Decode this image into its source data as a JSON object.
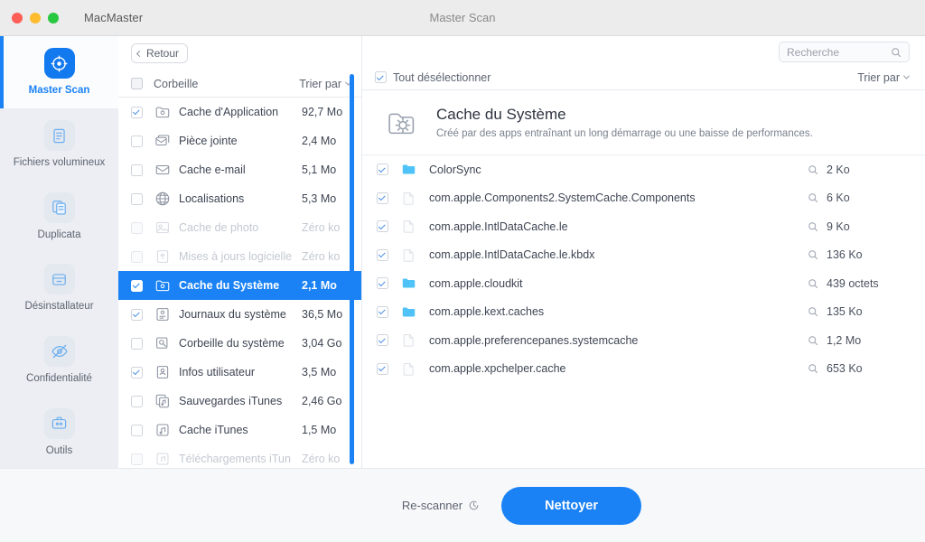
{
  "window": {
    "app_name": "MacMaster",
    "title": "Master Scan"
  },
  "sidebar": {
    "items": [
      {
        "label": "Master Scan",
        "icon": "target-scan-icon",
        "active": true
      },
      {
        "label": "Fichiers volumineux",
        "icon": "document-icon",
        "active": false
      },
      {
        "label": "Duplicata",
        "icon": "copy-documents-icon",
        "active": false
      },
      {
        "label": "Désinstallateur",
        "icon": "box-icon",
        "active": false
      },
      {
        "label": "Confidentialité",
        "icon": "eye-off-icon",
        "active": false
      },
      {
        "label": "Outils",
        "icon": "toolbox-icon",
        "active": false
      }
    ]
  },
  "toolbar": {
    "back_label": "Retour",
    "search_placeholder": "Recherche"
  },
  "middle_panel": {
    "header_title": "Corbeille",
    "sort_label": "Trier par",
    "rows": [
      {
        "name": "Cache d'Application",
        "size": "92,7 Mo",
        "checked": true,
        "dim": false,
        "selected": false,
        "icon": "app-cache-folder-icon"
      },
      {
        "name": "Pièce jointe",
        "size": "2,4 Mo",
        "checked": false,
        "dim": false,
        "selected": false,
        "icon": "mail-attachment-icon"
      },
      {
        "name": "Cache e-mail",
        "size": "5,1 Mo",
        "checked": false,
        "dim": false,
        "selected": false,
        "icon": "mail-icon"
      },
      {
        "name": "Localisations",
        "size": "5,3 Mo",
        "checked": false,
        "dim": false,
        "selected": false,
        "icon": "globe-icon"
      },
      {
        "name": "Cache de photo",
        "size": "Zéro ko",
        "checked": false,
        "dim": true,
        "selected": false,
        "icon": "photo-cache-icon"
      },
      {
        "name": "Mises à jours logicielle",
        "size": "Zéro ko",
        "checked": false,
        "dim": true,
        "selected": false,
        "icon": "software-update-icon"
      },
      {
        "name": "Cache du Système",
        "size": "2,1 Mo",
        "checked": true,
        "dim": false,
        "selected": true,
        "icon": "system-cache-icon"
      },
      {
        "name": "Journaux du système",
        "size": "36,5 Mo",
        "checked": true,
        "dim": false,
        "selected": false,
        "icon": "system-logs-icon"
      },
      {
        "name": "Corbeille du système",
        "size": "3,04 Go",
        "checked": false,
        "dim": false,
        "selected": false,
        "icon": "system-trash-icon"
      },
      {
        "name": "Infos utilisateur",
        "size": "3,5 Mo",
        "checked": true,
        "dim": false,
        "selected": false,
        "icon": "user-info-icon"
      },
      {
        "name": "Sauvegardes iTunes",
        "size": "2,46 Go",
        "checked": false,
        "dim": false,
        "selected": false,
        "icon": "itunes-backup-icon"
      },
      {
        "name": "Cache iTunes",
        "size": "1,5 Mo",
        "checked": false,
        "dim": false,
        "selected": false,
        "icon": "itunes-cache-icon"
      },
      {
        "name": "Téléchargements iTun",
        "size": "Zéro ko",
        "checked": false,
        "dim": true,
        "selected": false,
        "icon": "itunes-downloads-icon"
      }
    ]
  },
  "right_panel": {
    "deselect_all_label": "Tout désélectionner",
    "sort_label": "Trier par",
    "hero_title": "Cache du Système",
    "hero_subtitle": "Créé par des apps entraînant un long démarrage ou une baisse de performances.",
    "files": [
      {
        "name": "ColorSync",
        "size": "2 Ko",
        "type": "folder",
        "checked": true
      },
      {
        "name": "com.apple.Components2.SystemCache.Components",
        "size": "6 Ko",
        "type": "file",
        "checked": true
      },
      {
        "name": "com.apple.IntlDataCache.le",
        "size": "9 Ko",
        "type": "file",
        "checked": true
      },
      {
        "name": "com.apple.IntlDataCache.le.kbdx",
        "size": "136 Ko",
        "type": "file",
        "checked": true
      },
      {
        "name": "com.apple.cloudkit",
        "size": "439 octets",
        "type": "folder",
        "checked": true
      },
      {
        "name": "com.apple.kext.caches",
        "size": "135 Ko",
        "type": "folder",
        "checked": true
      },
      {
        "name": "com.apple.preferencepanes.systemcache",
        "size": "1,2 Mo",
        "type": "file",
        "checked": true
      },
      {
        "name": "com.apple.xpchelper.cache",
        "size": "653 Ko",
        "type": "file",
        "checked": true
      }
    ]
  },
  "footer": {
    "rescan_label": "Re-scanner",
    "clean_label": "Nettoyer"
  },
  "colors": {
    "accent": "#1a82f5",
    "folder": "#4fc3f7",
    "sidebar_bg": "#eceef3"
  }
}
